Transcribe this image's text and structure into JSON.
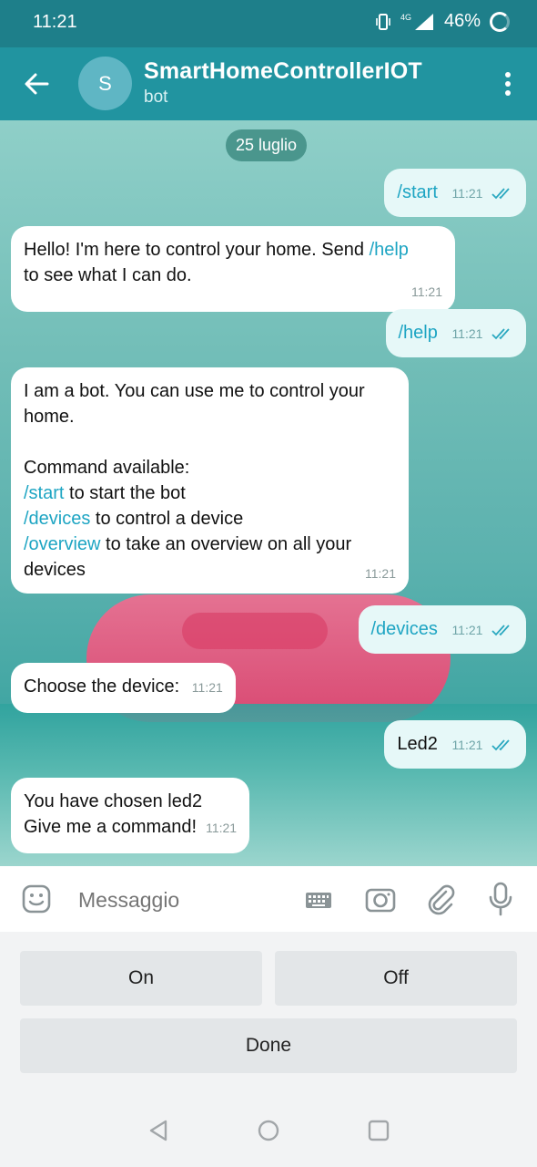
{
  "status_bar": {
    "time": "11:21",
    "network": "4G",
    "battery": "46%"
  },
  "header": {
    "avatar_letter": "S",
    "title": "SmartHomeControllerIOT",
    "subtitle": "bot"
  },
  "chat": {
    "date": "25 luglio",
    "messages": [
      {
        "dir": "out",
        "text": "/start",
        "time": "11:21"
      },
      {
        "dir": "in",
        "line1_a": "Hello! I'm here to control your home. Send ",
        "line1_cmd": "/help",
        "line2": "to see what I can do.",
        "time": "11:21"
      },
      {
        "dir": "out",
        "text": "/help",
        "time": "11:21"
      },
      {
        "dir": "in",
        "p1": "I am a bot. You can use me to control your home.",
        "p2": "Command available:",
        "cmd1": "/start",
        "cmd1_desc": " to start the bot",
        "cmd2": "/devices",
        "cmd2_desc": " to control a device",
        "cmd3": "/overview",
        "cmd3_desc": " to take an overview on all your devices",
        "time": "11:21"
      },
      {
        "dir": "out",
        "text": "/devices",
        "time": "11:21"
      },
      {
        "dir": "in",
        "text": "Choose the device:",
        "time": "11:21"
      },
      {
        "dir": "out",
        "text": "Led2",
        "time": "11:21"
      },
      {
        "dir": "in",
        "line1": "You have chosen led2",
        "line2": "Give me a command!",
        "time": "11:21"
      }
    ]
  },
  "input": {
    "placeholder": "Messaggio"
  },
  "bot_keyboard": {
    "on": "On",
    "off": "Off",
    "done": "Done"
  },
  "colors": {
    "header": "#2194a0",
    "status_bar": "#1e7f8a",
    "command_link": "#1ea5c3",
    "outgoing_bubble": "#e6f8f8"
  },
  "icons": [
    "back-arrow-icon",
    "more-vert-icon",
    "emoji-icon",
    "keyboard-icon",
    "camera-icon",
    "paperclip-icon",
    "microphone-icon",
    "double-check-icon",
    "nav-back-icon",
    "nav-home-icon",
    "nav-recents-icon"
  ]
}
